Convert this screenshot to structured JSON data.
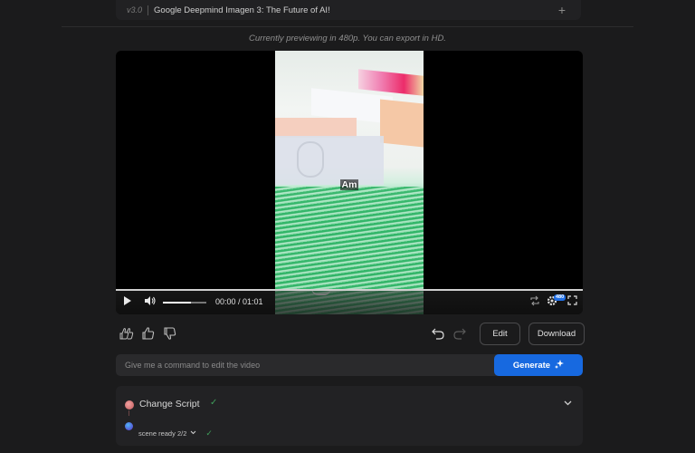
{
  "header": {
    "version": "v3.0",
    "title": "Google Deepmind Imagen 3: The Future of AI!",
    "add_icon": "plus-icon"
  },
  "preview_note": "Currently previewing in 480p. You can export in HD.",
  "player": {
    "caption": "Am",
    "current_time": "00:00",
    "duration": "01:01",
    "time_display": "00:00 / 01:01",
    "progress_fraction": 0.0,
    "volume_fraction": 0.65,
    "quality_badge": "480",
    "icons": [
      "play-icon",
      "volume-icon",
      "loop-icon",
      "settings-icon",
      "fullscreen-icon"
    ]
  },
  "actions": {
    "feedback_icons": [
      "thumbs-up-double-icon",
      "thumbs-up-icon",
      "thumbs-down-icon"
    ],
    "undo_icon": "undo-icon",
    "redo_icon": "redo-icon",
    "edit_label": "Edit",
    "download_label": "Download"
  },
  "command": {
    "placeholder": "Give me a command to edit the video",
    "value": "",
    "generate_label": "Generate",
    "generate_icon": "sparkle-icon"
  },
  "task": {
    "title": "Change Script",
    "status_icon": "check-icon",
    "sub_status": "scene ready 2/2",
    "accent_colors": {
      "check": "#3f9e5a",
      "primary": "#1769e0"
    }
  }
}
